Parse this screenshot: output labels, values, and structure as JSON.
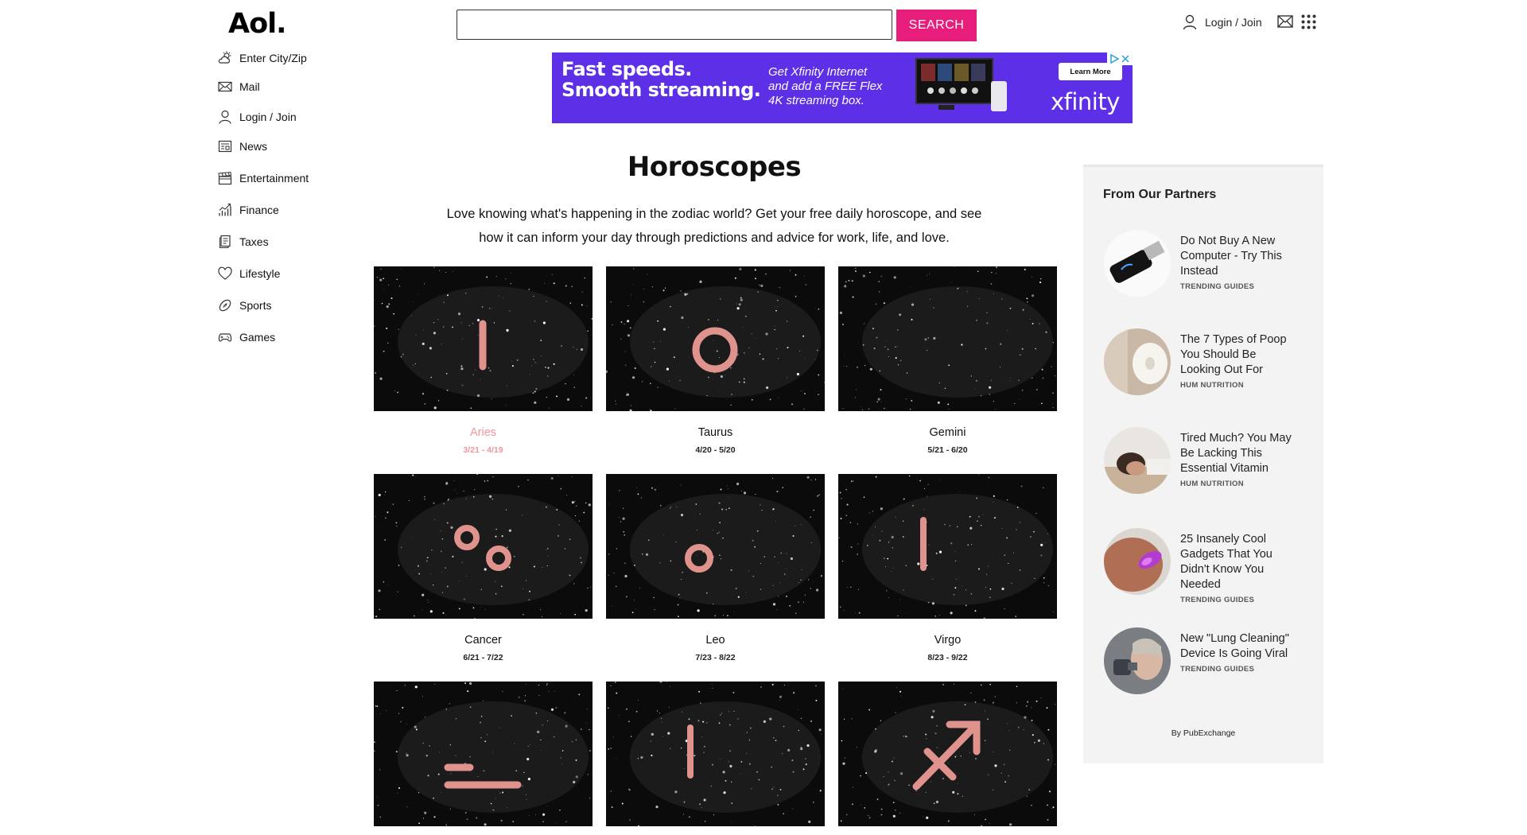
{
  "header": {
    "logo": "Aol.",
    "search_placeholder": "",
    "search_button": "SEARCH",
    "login": "Login / Join"
  },
  "nav": {
    "items": [
      {
        "label": "Enter City/Zip",
        "icon": "weather-icon"
      },
      {
        "label": "Mail",
        "icon": "mail-icon"
      },
      {
        "label": "Login / Join",
        "icon": "user-icon"
      },
      {
        "label": "News",
        "icon": "news-icon"
      },
      {
        "label": "Entertainment",
        "icon": "clapperboard-icon"
      },
      {
        "label": "Finance",
        "icon": "chart-icon"
      },
      {
        "label": "Taxes",
        "icon": "document-icon"
      },
      {
        "label": "Lifestyle",
        "icon": "heart-icon"
      },
      {
        "label": "Sports",
        "icon": "football-icon"
      },
      {
        "label": "Games",
        "icon": "gamepad-icon"
      }
    ]
  },
  "ad": {
    "headline": [
      "Fast speeds.",
      "Smooth streaming."
    ],
    "subtext": [
      "Get Xfinity Internet",
      "and add a FREE Flex",
      "4K streaming box."
    ],
    "cta": "Learn More",
    "brand": "xfinity",
    "accent": "#5d30e8"
  },
  "main": {
    "title": "Horoscopes",
    "intro": "Love knowing what's happening in the zodiac world? Get your free daily horoscope, and see how it can inform your day through predictions and advice for work, life, and love."
  },
  "signs": [
    {
      "name": "Aries",
      "dates": "3/21 - 4/19",
      "symbol": "aries-icon",
      "active": true
    },
    {
      "name": "Taurus",
      "dates": "4/20 - 5/20",
      "symbol": "taurus-icon",
      "active": false
    },
    {
      "name": "Gemini",
      "dates": "5/21 - 6/20",
      "symbol": "gemini-icon",
      "active": false
    },
    {
      "name": "Cancer",
      "dates": "6/21 - 7/22",
      "symbol": "cancer-icon",
      "active": false
    },
    {
      "name": "Leo",
      "dates": "7/23 - 8/22",
      "symbol": "leo-icon",
      "active": false
    },
    {
      "name": "Virgo",
      "dates": "8/23 - 9/22",
      "symbol": "virgo-icon",
      "active": false
    },
    {
      "name": "",
      "dates": "",
      "symbol": "libra-icon",
      "active": false
    },
    {
      "name": "",
      "dates": "",
      "symbol": "scorpio-icon",
      "active": false
    },
    {
      "name": "",
      "dates": "",
      "symbol": "sagittarius-icon",
      "active": false
    }
  ],
  "colors": {
    "brand_pink": "#e71e7b",
    "symbol_color": "#e0938c",
    "active_sign": "#f0969c"
  },
  "partners": {
    "title": "From Our Partners",
    "items": [
      {
        "text": "Do Not Buy A New Computer - Try This Instead",
        "source": "TRENDING GUIDES"
      },
      {
        "text": "The 7 Types of Poop You Should Be Looking Out For",
        "source": "HUM NUTRITION"
      },
      {
        "text": "Tired Much? You May Be Lacking This Essential Vitamin",
        "source": "HUM NUTRITION"
      },
      {
        "text": "25 Insanely Cool Gadgets That You Didn't Know You Needed",
        "source": "TRENDING GUIDES"
      },
      {
        "text": "New \"Lung Cleaning\" Device Is Going Viral",
        "source": "TRENDING GUIDES"
      }
    ],
    "by": "By PubExchange"
  }
}
